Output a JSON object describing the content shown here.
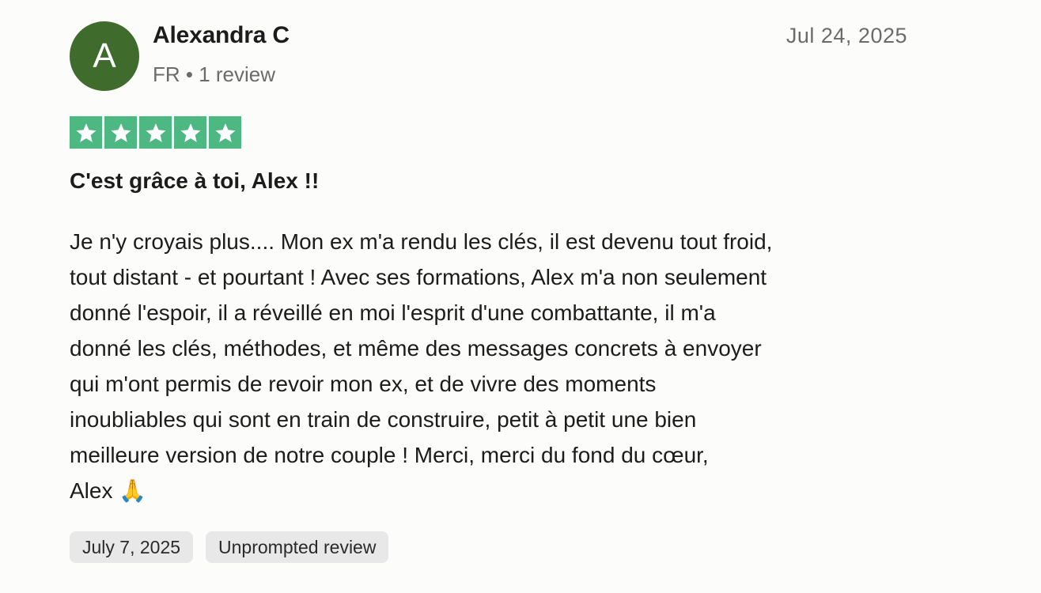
{
  "author": {
    "initial": "A",
    "name": "Alexandra C",
    "meta": "FR • 1 review"
  },
  "review": {
    "date": "Jul 24, 2025",
    "rating": 5,
    "rating_max": 5,
    "star_color": "#4eb883",
    "title": "C'est grâce à toi, Alex !!",
    "body": "Je n'y croyais plus.... Mon ex m'a rendu les clés, il est devenu tout froid,\ntout distant - et pourtant ! Avec ses formations, Alex m'a non seulement\ndonné l'espoir, il a réveillé en moi l'esprit d'une combattante, il m'a\ndonné les clés, méthodes, et même des messages concrets à envoyer\nqui m'ont permis de revoir mon ex, et de vivre des moments\ninoubliables qui sont en train de construire, petit à petit une bien\nmeilleure version de notre couple ! Merci, merci du fond du cœur,\nAlex 🙏"
  },
  "tags": {
    "experience_date": "July 7, 2025",
    "review_type": "Unprompted review"
  },
  "colors": {
    "avatar_bg": "#3f6b2c",
    "tag_bg": "#e8e8e8"
  }
}
